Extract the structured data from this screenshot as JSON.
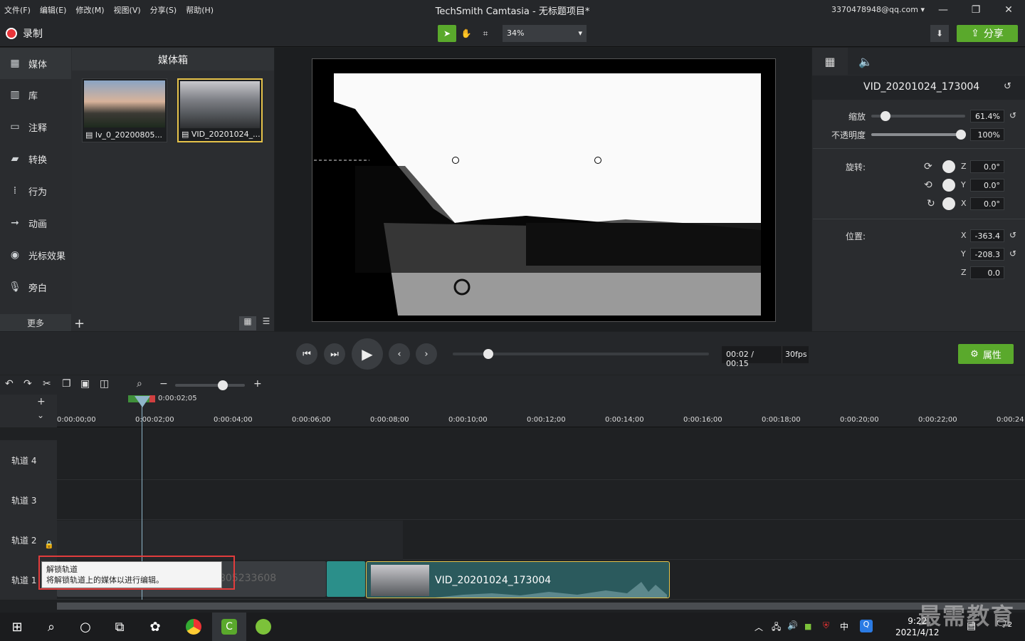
{
  "window": {
    "title": "TechSmith Camtasia - 无标题项目*",
    "account": "3370478948@qq.com",
    "menu": [
      "文件(F)",
      "编辑(E)",
      "修改(M)",
      "视图(V)",
      "分享(S)",
      "帮助(H)"
    ]
  },
  "toolbar": {
    "record_label": "录制",
    "zoom_value": "34%",
    "share_label": "分享"
  },
  "sidebar": {
    "items": [
      {
        "label": "媒体",
        "icon": "film-icon"
      },
      {
        "label": "库",
        "icon": "library-icon"
      },
      {
        "label": "注释",
        "icon": "annotation-icon"
      },
      {
        "label": "转换",
        "icon": "transition-icon"
      },
      {
        "label": "行为",
        "icon": "behavior-icon"
      },
      {
        "label": "动画",
        "icon": "animation-icon"
      },
      {
        "label": "光标效果",
        "icon": "cursor-icon"
      },
      {
        "label": "旁白",
        "icon": "mic-icon"
      }
    ],
    "more_label": "更多"
  },
  "media_bin": {
    "title": "媒体箱",
    "items": [
      "lv_0_20200805...",
      "VID_20201024_..."
    ]
  },
  "properties": {
    "clip_name": "VID_20201024_173004",
    "scale_label": "缩放",
    "scale_value": "61.4%",
    "opacity_label": "不透明度",
    "opacity_value": "100%",
    "rotation_label": "旋转:",
    "rotation": [
      {
        "axis": "Z",
        "value": "0.0°"
      },
      {
        "axis": "Y",
        "value": "0.0°"
      },
      {
        "axis": "X",
        "value": "0.0°"
      }
    ],
    "position_label": "位置:",
    "position": [
      {
        "axis": "X",
        "value": "-363.4"
      },
      {
        "axis": "Y",
        "value": "-208.3"
      },
      {
        "axis": "Z",
        "value": "0.0"
      }
    ],
    "properties_button": "属性"
  },
  "player": {
    "time": "00:02 / 00:15",
    "fps": "30fps",
    "progress_fraction": 0.14
  },
  "timeline": {
    "playhead_time": "0:00:02;05",
    "ticks": [
      "0:00:00;00",
      "0:00:02;00",
      "0:00:04;00",
      "0:00:06;00",
      "0:00:08;00",
      "0:00:10;00",
      "0:00:12;00",
      "0:00:14;00",
      "0:00:16;00",
      "0:00:18;00",
      "0:00:20;00",
      "0:00:22;00",
      "0:00:24"
    ],
    "tracks": [
      "轨道 4",
      "轨道 3",
      "轨道 2",
      "轨道 1"
    ],
    "clip_gray_label": "805233608",
    "clip_main_label": "VID_20201024_173004",
    "tooltip_title": "解锁轨道",
    "tooltip_body": "将解锁轨道上的媒体以进行编辑。"
  },
  "taskbar": {
    "time": "9:22",
    "date": "2021/4/12",
    "ime": "中",
    "notification_count": "2"
  },
  "watermark": "最需教育"
}
